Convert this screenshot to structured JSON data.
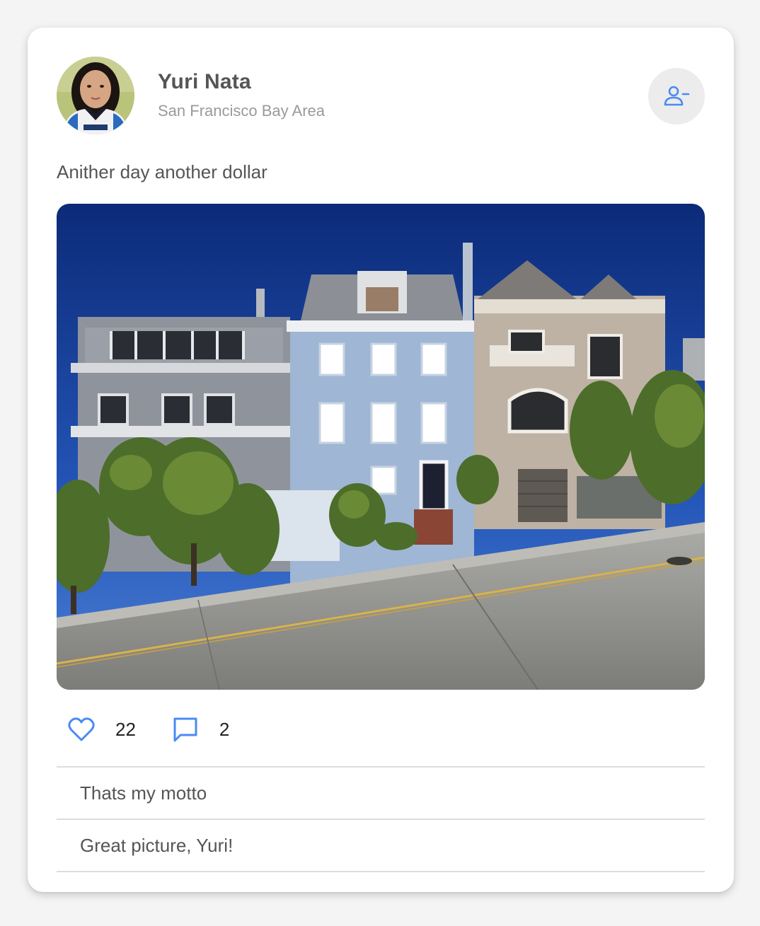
{
  "post": {
    "author": {
      "name": "Yuri Nata",
      "location": "San Francisco Bay Area",
      "avatar_icon": "profile-photo"
    },
    "text": "Anither day another dollar",
    "photo_icon": "house-street-photo",
    "unfollow_icon": "person-remove-icon",
    "likes": "22",
    "comments_count": "2"
  },
  "comments": [
    {
      "text": "Thats my motto"
    },
    {
      "text": "Great picture, Yuri!"
    }
  ],
  "colors": {
    "accent": "#4a8af4",
    "text": "#555555",
    "muted": "#9a9a9a",
    "divider": "#dddddd",
    "card": "#ffffff",
    "page": "#f4f4f4"
  }
}
